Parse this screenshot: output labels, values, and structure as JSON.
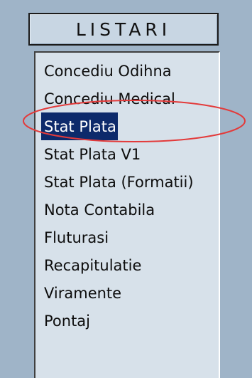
{
  "header": {
    "title": "LISTARI"
  },
  "list": {
    "items": [
      {
        "label": "Concediu Odihna",
        "selected": false
      },
      {
        "label": "Concediu Medical",
        "selected": false
      },
      {
        "label": "Stat Plata",
        "selected": true
      },
      {
        "label": "Stat Plata V1",
        "selected": false
      },
      {
        "label": "Stat Plata (Formatii)",
        "selected": false
      },
      {
        "label": "Nota Contabila",
        "selected": false
      },
      {
        "label": "Fluturasi",
        "selected": false
      },
      {
        "label": "Recapitulatie",
        "selected": false
      },
      {
        "label": "Viramente",
        "selected": false
      },
      {
        "label": "Pontaj",
        "selected": false
      }
    ]
  },
  "colors": {
    "background": "#9fb4c8",
    "list_background": "#d7e1ea",
    "selected_background": "#0d2a6b",
    "selected_text": "#ffffff",
    "annotation": "#e33a3a"
  }
}
